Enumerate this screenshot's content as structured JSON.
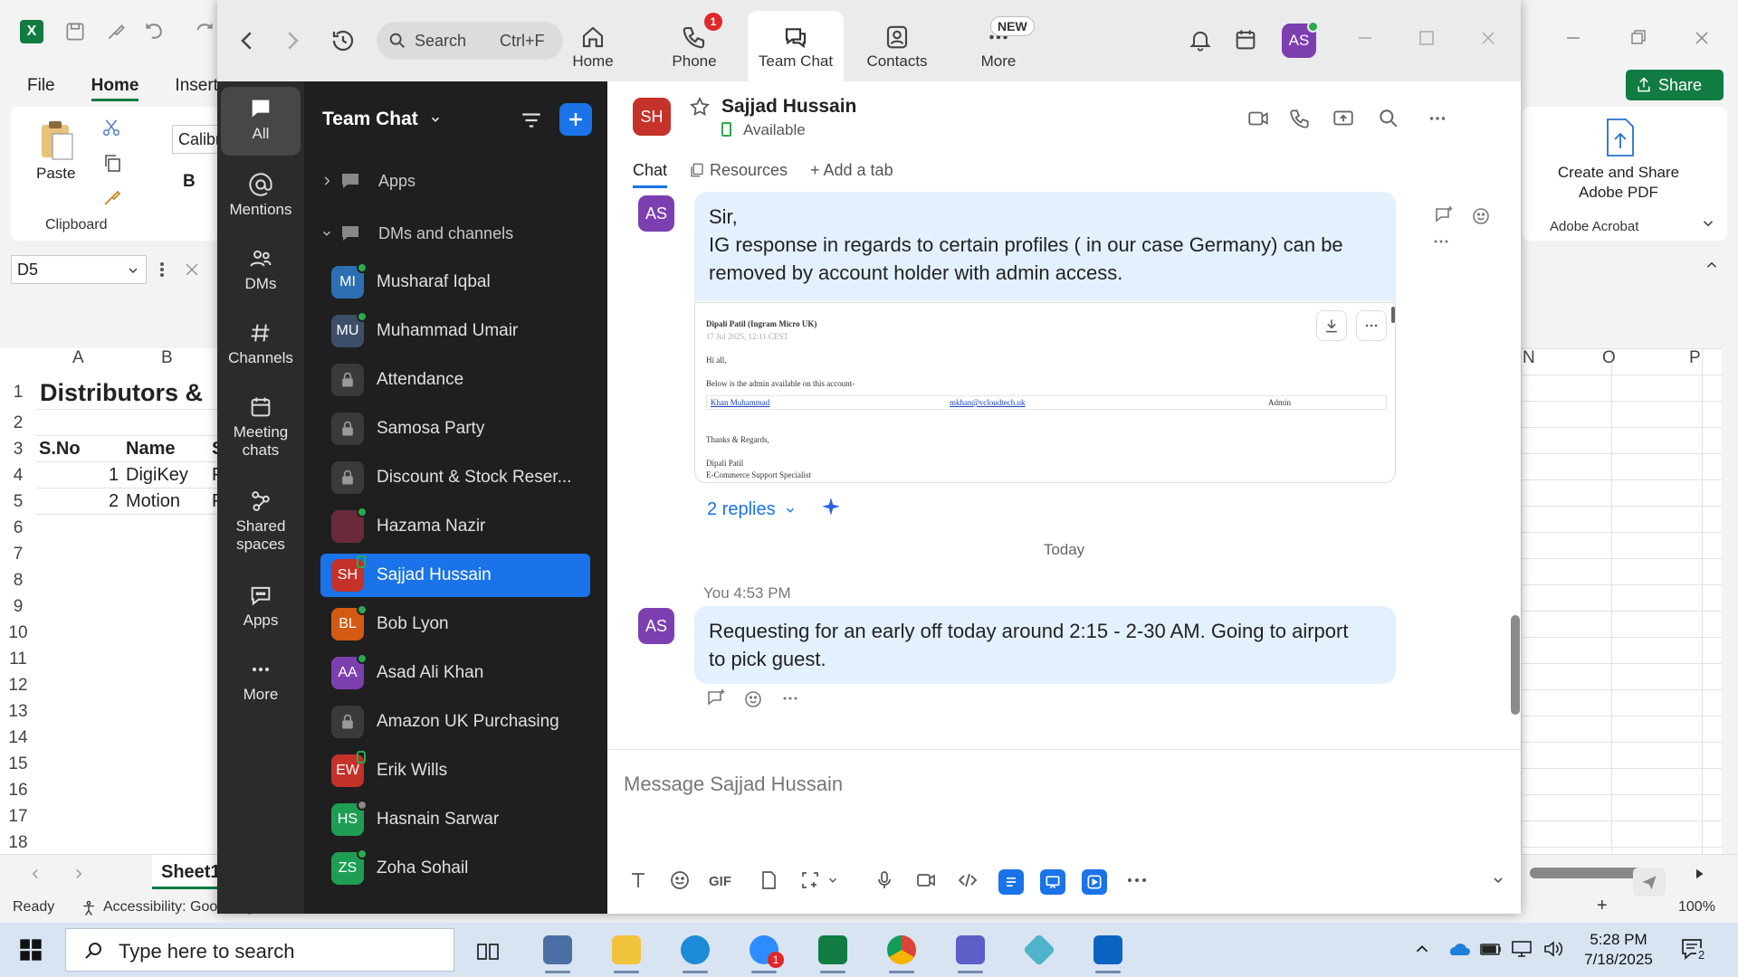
{
  "excel": {
    "logo": "X",
    "menus": [
      "File",
      "Home",
      "Insert"
    ],
    "active_menu": "Home",
    "share_label": "Share",
    "clipboard": {
      "paste": "Paste",
      "group": "Clipboard",
      "font_box": "Calibri",
      "bold": "B"
    },
    "adobe": {
      "label": "Create and Share Adobe PDF",
      "group": "Adobe Acrobat"
    },
    "namebox": "D5",
    "columns_left": [
      "A",
      "B"
    ],
    "columns_right": [
      "N",
      "O",
      "P"
    ],
    "row_numbers": [
      "1",
      "2",
      "3",
      "4",
      "5",
      "6",
      "7",
      "8",
      "9",
      "10",
      "11",
      "12",
      "13",
      "14",
      "15",
      "16",
      "17",
      "18"
    ],
    "title_cell": "Distributors &",
    "header_row": {
      "a": "S.No",
      "b": "Name",
      "c": "S"
    },
    "rows": [
      {
        "a": "1",
        "b": "DigiKey",
        "c": "F"
      },
      {
        "a": "2",
        "b": "Motion",
        "c": "F"
      }
    ],
    "sheet_tab": "Sheet1",
    "status": {
      "ready": "Ready",
      "accessibility": "Accessibility: Good to go",
      "zoom": "100%"
    }
  },
  "zoom": {
    "search": {
      "label": "Search",
      "shortcut": "Ctrl+F"
    },
    "top_tabs": [
      {
        "label": "Home",
        "icon": "house-icon"
      },
      {
        "label": "Phone",
        "icon": "phone-icon",
        "badge": "1"
      },
      {
        "label": "Team Chat",
        "icon": "chat-icon"
      },
      {
        "label": "Contacts",
        "icon": "contacts-icon"
      },
      {
        "label": "More",
        "icon": "more-icon",
        "badge": "NEW"
      }
    ],
    "active_top_tab": "Team Chat",
    "user_initials": "AS",
    "rail": [
      {
        "label": "All",
        "icon": "chat-bubble-icon"
      },
      {
        "label": "Mentions",
        "icon": "at-icon"
      },
      {
        "label": "DMs",
        "icon": "people-icon"
      },
      {
        "label": "Channels",
        "icon": "hash-icon"
      },
      {
        "label": "Meeting chats",
        "icon": "calendar-icon"
      },
      {
        "label": "Shared spaces",
        "icon": "shared-spaces-icon"
      },
      {
        "label": "Apps",
        "icon": "apps-icon"
      },
      {
        "label": "More",
        "icon": "ellipsis-icon"
      }
    ],
    "chat_list": {
      "title": "Team Chat",
      "sections": {
        "apps": "Apps",
        "dms": "DMs and channels"
      },
      "items": [
        {
          "name": "Musharaf Iqbal",
          "initials": "MI",
          "color": "#2d6fb3",
          "presence": "online"
        },
        {
          "name": "Muhammad Umair",
          "initials": "MU",
          "color": "#3d4f68",
          "presence": "online"
        },
        {
          "name": "Attendance",
          "initials": "",
          "color": "#3a3a3a",
          "presence": "lock"
        },
        {
          "name": "Samosa Party",
          "initials": "",
          "color": "#3a3a3a",
          "presence": "lock"
        },
        {
          "name": "Discount & Stock Reser...",
          "initials": "",
          "color": "#3a3a3a",
          "presence": "lock"
        },
        {
          "name": "Hazama Nazir",
          "initials": "",
          "color": "#6a2a3a",
          "presence": "online"
        },
        {
          "name": "Sajjad Hussain",
          "initials": "SH",
          "color": "#c4322a",
          "presence": "mobile"
        },
        {
          "name": "Bob Lyon",
          "initials": "BL",
          "color": "#d35a12",
          "presence": "online"
        },
        {
          "name": "Asad Ali Khan",
          "initials": "AA",
          "color": "#7d3fb0",
          "presence": "online"
        },
        {
          "name": "Amazon UK Purchasing",
          "initials": "",
          "color": "#3a3a3a",
          "presence": "lock"
        },
        {
          "name": "Erik Wills",
          "initials": "EW",
          "color": "#c4322a",
          "presence": "mobile"
        },
        {
          "name": "Hasnain Sarwar",
          "initials": "HS",
          "color": "#1f9d55",
          "presence": "away"
        },
        {
          "name": "Zoha Sohail",
          "initials": "ZS",
          "color": "#1f9d55",
          "presence": "online"
        }
      ],
      "active": "Sajjad Hussain"
    },
    "chat": {
      "contact_name": "Sajjad Hussain",
      "contact_initials": "SH",
      "status": "Available",
      "tabs": [
        "Chat",
        "Resources",
        "+ Add a tab"
      ],
      "messages": [
        {
          "avatar": "AS",
          "text_lines": [
            "Sir,",
            "IG response in regards to certain profiles ( in our case Germany) can be",
            "removed by account holder with admin access."
          ],
          "attachment": {
            "from": "Dipali Patil (Ingram Micro UK)",
            "date": "17 Jul 2025, 12:11 CEST",
            "greeting": "Hi all,",
            "intro": "Below is the admin available on this account-",
            "admin_name": "Khan Muhammad",
            "admin_email": "mkhan@vcloudtech.uk",
            "admin_role": "Admin",
            "signoff": "Thanks & Regards,",
            "sig_name": "Dipali Patil",
            "sig_title": "E-Commerce Support Specialist"
          },
          "replies": "2 replies"
        }
      ],
      "date_separator": "Today",
      "own_message": {
        "sender": "You 4:53 PM",
        "avatar": "AS",
        "text_lines": [
          "Requesting for an early off today around 2:15 - 2-30 AM. Going to airport",
          "to pick guest."
        ]
      },
      "composer_placeholder": "Message Sajjad Hussain",
      "composer_value": ""
    }
  },
  "taskbar": {
    "search_placeholder": "Type here to search",
    "zoom_badge": "1",
    "clock_time": "5:28 PM",
    "clock_date": "7/18/2025",
    "notification_count": "2"
  }
}
